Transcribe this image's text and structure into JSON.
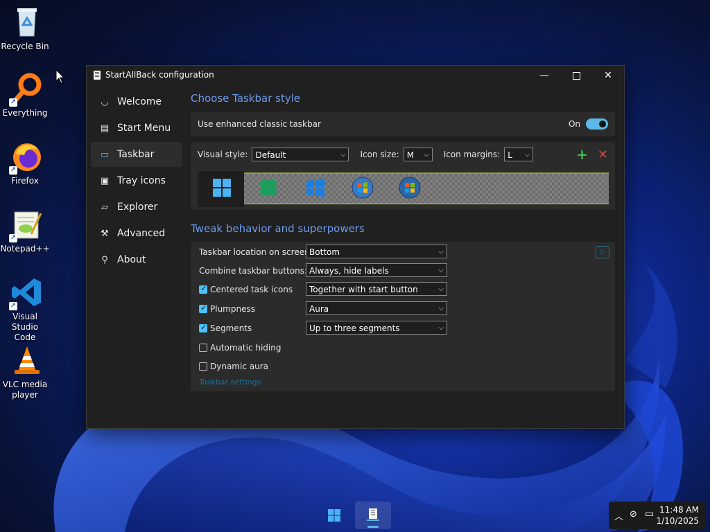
{
  "desktop": {
    "icons": [
      {
        "label": "Recycle Bin"
      },
      {
        "label": "Everything"
      },
      {
        "label": "Firefox"
      },
      {
        "label": "Notepad++"
      },
      {
        "label": "Visual Studio Code"
      },
      {
        "label": "VLC media player"
      }
    ]
  },
  "window": {
    "title": "StartAllBack configuration",
    "controls": {
      "minimize": "—",
      "close": "✕"
    }
  },
  "sidebar": {
    "items": [
      {
        "label": "Welcome",
        "icon": "smile-icon"
      },
      {
        "label": "Start Menu",
        "icon": "start-menu-icon"
      },
      {
        "label": "Taskbar",
        "icon": "taskbar-icon"
      },
      {
        "label": "Tray icons",
        "icon": "tray-icon"
      },
      {
        "label": "Explorer",
        "icon": "folder-icon"
      },
      {
        "label": "Advanced",
        "icon": "wrench-icon"
      },
      {
        "label": "About",
        "icon": "info-icon"
      }
    ],
    "active": "Taskbar"
  },
  "taskbar_style": {
    "title": "Choose Taskbar style",
    "enhanced_label": "Use enhanced classic taskbar",
    "toggle_state": "On",
    "visual_style_label": "Visual style:",
    "visual_style_value": "Default",
    "icon_size_label": "Icon size:",
    "icon_size_value": "M",
    "icon_margins_label": "Icon margins:",
    "icon_margins_value": "L",
    "add_symbol": "+",
    "remove_symbol": "✕"
  },
  "tweak": {
    "title": "Tweak behavior and superpowers",
    "location_label": "Taskbar location on screen:",
    "location_value": "Bottom",
    "combine_label": "Combine taskbar buttons:",
    "combine_value": "Always, hide labels",
    "centered_label": "Centered task icons",
    "centered_value": "Together with start button",
    "plumpness_label": "Plumpness",
    "plumpness_value": "Aura",
    "segments_label": "Segments",
    "segments_value": "Up to three segments",
    "autohide_label": "Automatic hiding",
    "dynamic_label": "Dynamic aura",
    "settings_link": "Taskbar settings"
  },
  "taskbar": {
    "time": "11:48 AM",
    "date": "1/10/2025"
  },
  "colors": {
    "accent": "#6c9bea",
    "toggle": "#5bb8e8",
    "checkbox": "#4cc2ff",
    "add": "#3cbf4a",
    "remove": "#d54545"
  }
}
